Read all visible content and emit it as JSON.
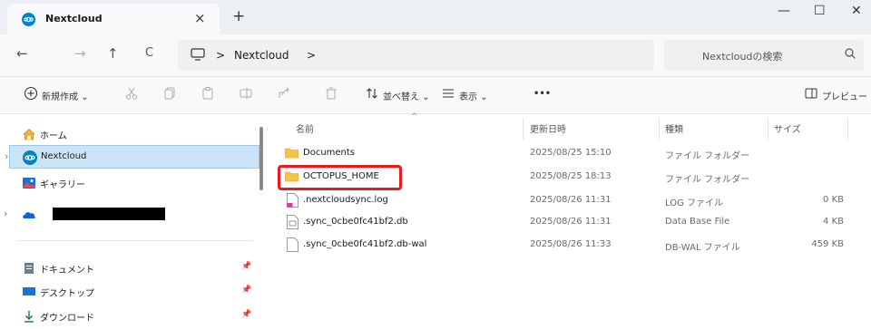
{
  "tab": {
    "title": "Nextcloud",
    "close": "×",
    "new_tab": "+"
  },
  "window": {
    "minimize": "—",
    "maximize": "☐",
    "close": "✕"
  },
  "nav": {
    "back": "←",
    "forward": "→",
    "up": "↑",
    "refresh": "C"
  },
  "address": {
    "sep1": ">",
    "folder": "Nextcloud",
    "sep2": ">"
  },
  "search": {
    "placeholder": "Nextcloudの検索"
  },
  "toolbar": {
    "new_label": "新規作成",
    "sort_label": "並べ替え",
    "view_label": "表示",
    "more": "•••",
    "preview_label": "プレビュー"
  },
  "sidebar": {
    "home": "ホーム",
    "nextcloud": "Nextcloud",
    "gallery": "ギャラリー",
    "documents": "ドキュメント",
    "desktop": "デスクトップ",
    "downloads": "ダウンロード"
  },
  "columns": {
    "name": "名前",
    "modified": "更新日時",
    "type": "種類",
    "size": "サイズ"
  },
  "files": [
    {
      "name": "Documents",
      "modified": "2025/08/25 15:10",
      "type": "ファイル フォルダー",
      "size": "",
      "icon": "folder-icon"
    },
    {
      "name": "OCTOPUS_HOME",
      "modified": "2025/08/25 18:13",
      "type": "ファイル フォルダー",
      "size": "",
      "icon": "folder-icon"
    },
    {
      "name": ".nextcloudsync.log",
      "modified": "2025/08/26 11:31",
      "type": "LOG ファイル",
      "size": "0 KB",
      "icon": "log-file-icon"
    },
    {
      "name": ".sync_0cbe0fc41bf2.db",
      "modified": "2025/08/26 11:31",
      "type": "Data Base File",
      "size": "4 KB",
      "icon": "db-file-icon"
    },
    {
      "name": ".sync_0cbe0fc41bf2.db-wal",
      "modified": "2025/08/26 11:33",
      "type": "DB-WAL ファイル",
      "size": "459 KB",
      "icon": "file-icon"
    }
  ],
  "colors": {
    "selected": "#cce4f7",
    "highlight": "#e81c1c",
    "folder": "#f4c542",
    "nextcloud": "#0082c9"
  }
}
